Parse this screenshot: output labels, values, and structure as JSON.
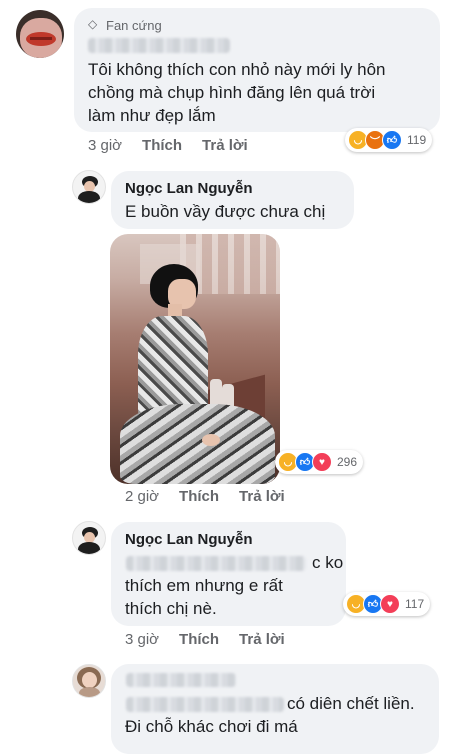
{
  "comments": [
    {
      "badge": "Fan cứng",
      "lines": [
        "Tôi không thích con nhỏ này mới ly hôn",
        "chồng mà chụp hình đăng lên quá trời",
        "làm như đẹp lắm"
      ],
      "time": "3 giờ",
      "like": "Thích",
      "reply": "Trả lời",
      "reaction_count": "119"
    },
    {
      "name": "Ngọc Lan Nguyễn",
      "text": "E buồn vầy được chưa chị",
      "time": "2 giờ",
      "like": "Thích",
      "reply": "Trả lời",
      "reaction_count": "296"
    },
    {
      "name": "Ngọc Lan Nguyễn",
      "line1_end": "c ko",
      "line2": "thích em nhưng e rất",
      "line3": "thích chị nè.",
      "time": "3 giờ",
      "like": "Thích",
      "reply": "Trả lời",
      "reaction_count": "117"
    },
    {
      "line1_end": "có diên chết liền.",
      "line2": "Đi chỗ khác chơi đi má"
    }
  ],
  "icons": {
    "badge": "diamond-icon",
    "reactions": [
      "haha-icon",
      "angry-icon",
      "like-icon",
      "love-icon"
    ]
  },
  "colors": {
    "like": "#1877f2",
    "love": "#f33e58",
    "haha": "#f7b125",
    "angry": "#e9710f",
    "bubble": "#f0f2f5"
  }
}
